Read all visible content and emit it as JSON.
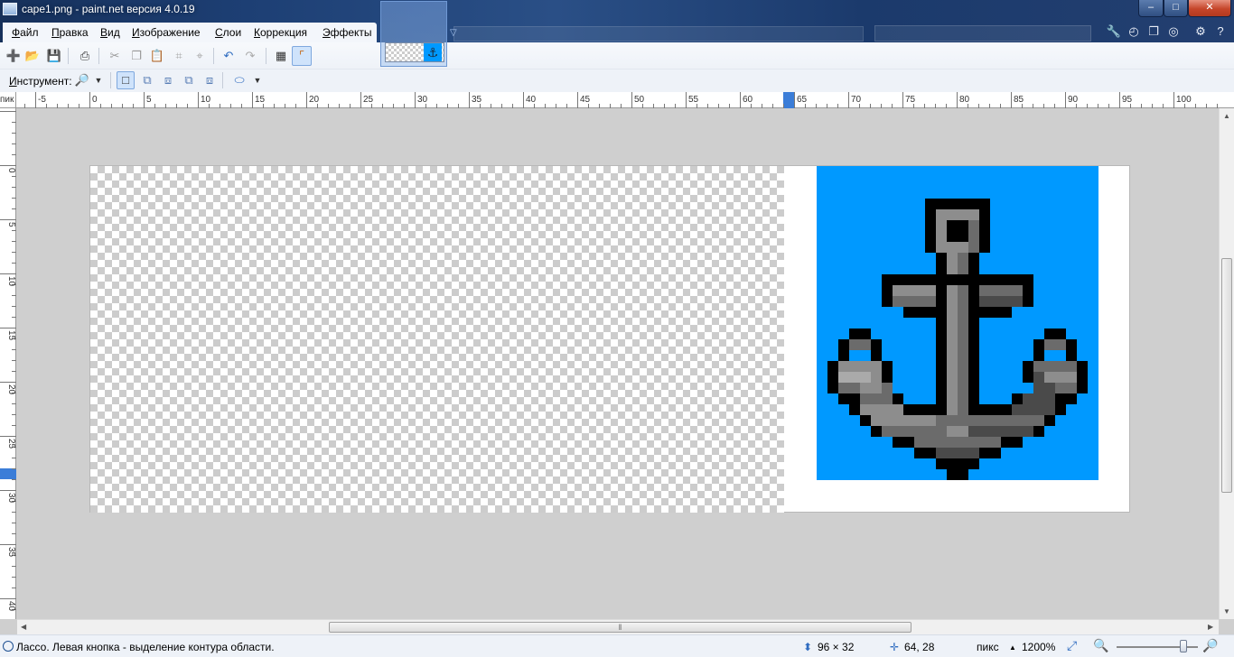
{
  "window": {
    "title": "cape1.png - paint.net версия 4.0.19",
    "minimize_label": "–",
    "maximize_label": "□",
    "close_label": "✕"
  },
  "menu": {
    "items": [
      {
        "label": "Файл",
        "underline": "Ф",
        "rest": "айл"
      },
      {
        "label": "Правка",
        "underline": "П",
        "rest": "равка"
      },
      {
        "label": "Вид",
        "underline": "В",
        "rest": "ид"
      },
      {
        "label": "Изображение",
        "underline": "И",
        "rest": "зображение"
      },
      {
        "label": "Слои",
        "underline": "С",
        "rest": "лои"
      },
      {
        "label": "Коррекция",
        "underline": "К",
        "rest": "оррекция"
      },
      {
        "label": "Эффекты",
        "underline": "Э",
        "rest": "ффекты"
      }
    ]
  },
  "toolbar": {
    "tool_label_prefix": "И",
    "tool_label_rest": "нструмент:",
    "tool_icon": "magnifier-icon"
  },
  "rulers": {
    "unit_abbrev": "пик",
    "top_labels": [
      "-5",
      "0",
      "5",
      "10",
      "15",
      "20",
      "25",
      "30",
      "35",
      "40",
      "45",
      "50",
      "55",
      "60",
      "65",
      "70",
      "75",
      "80",
      "85",
      "90",
      "95",
      "100"
    ],
    "left_labels": [
      "0",
      "5",
      "10",
      "15",
      "20",
      "25",
      "30",
      "35",
      "40"
    ]
  },
  "image_tab": {
    "thumb_icon": "⚓"
  },
  "status": {
    "hint": "Лассо. Левая кнопка - выделение контура области.",
    "image_size": "96 × 32",
    "cursor_position": "64, 28",
    "units": "пикс",
    "zoom": "1200%"
  },
  "colors": {
    "anchor_background": "#0099ff",
    "canvas_background": "#cfcfcf",
    "close_button": "#c5452a"
  }
}
